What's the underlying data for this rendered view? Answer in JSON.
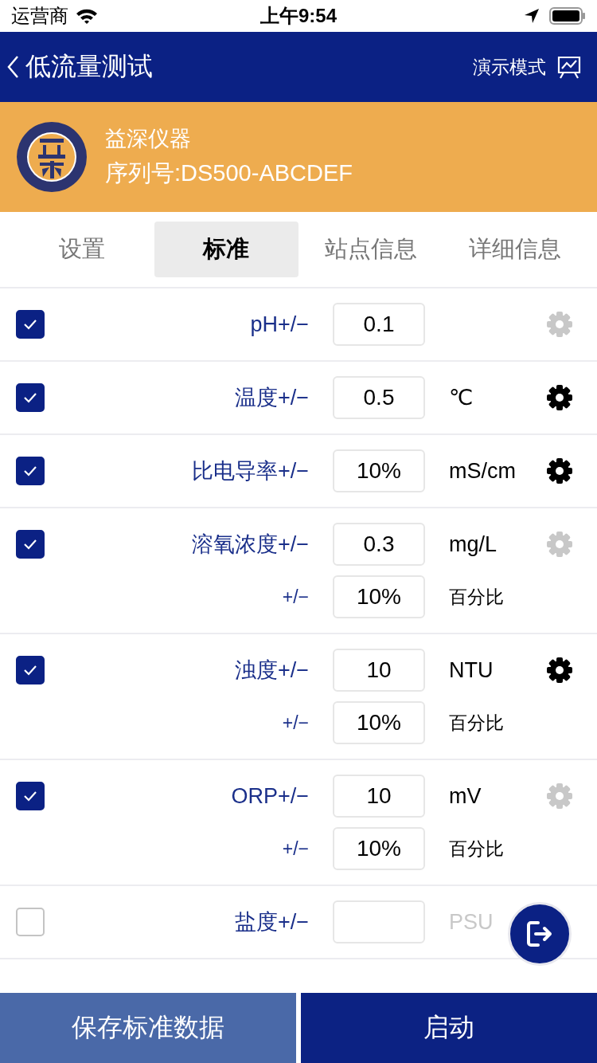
{
  "status_bar": {
    "carrier": "运营商",
    "time": "上午9:54"
  },
  "nav": {
    "title": "低流量测试",
    "mode": "演示模式"
  },
  "device": {
    "name": "益深仪器",
    "serial": "序列号:DS500-ABCDEF"
  },
  "tabs": [
    {
      "label": "设置",
      "selected": false
    },
    {
      "label": "标准",
      "selected": true
    },
    {
      "label": "站点信息",
      "selected": false
    },
    {
      "label": "详细信息",
      "selected": false
    }
  ],
  "rows": [
    {
      "checked": true,
      "label": "pH+/−",
      "value": "0.1",
      "gear_active": false
    },
    {
      "checked": true,
      "label": "温度+/−",
      "value": "0.5",
      "unit": "℃",
      "gear_active": true
    },
    {
      "checked": true,
      "label": "比电导率+/−",
      "value": "10%",
      "unit": "mS/cm",
      "gear_active": true
    },
    {
      "checked": true,
      "label": "溶氧浓度+/−",
      "value": "0.3",
      "unit": "mg/L",
      "gear_active": false,
      "secondary": {
        "label": "+/−",
        "value": "10%",
        "unit": "百分比"
      }
    },
    {
      "checked": true,
      "label": "浊度+/−",
      "value": "10",
      "unit": "NTU",
      "gear_active": true,
      "secondary": {
        "label": "+/−",
        "value": "10%",
        "unit": "百分比"
      }
    },
    {
      "checked": true,
      "label": "ORP+/−",
      "value": "10",
      "unit": "mV",
      "gear_active": false,
      "secondary": {
        "label": "+/−",
        "value": "10%",
        "unit": "百分比"
      }
    },
    {
      "checked": false,
      "label": "盐度+/−",
      "unit": "PSU"
    }
  ],
  "buttons": [
    {
      "label": "保存标准数据",
      "kind": "secondary"
    },
    {
      "label": "启动",
      "kind": "primary"
    }
  ]
}
